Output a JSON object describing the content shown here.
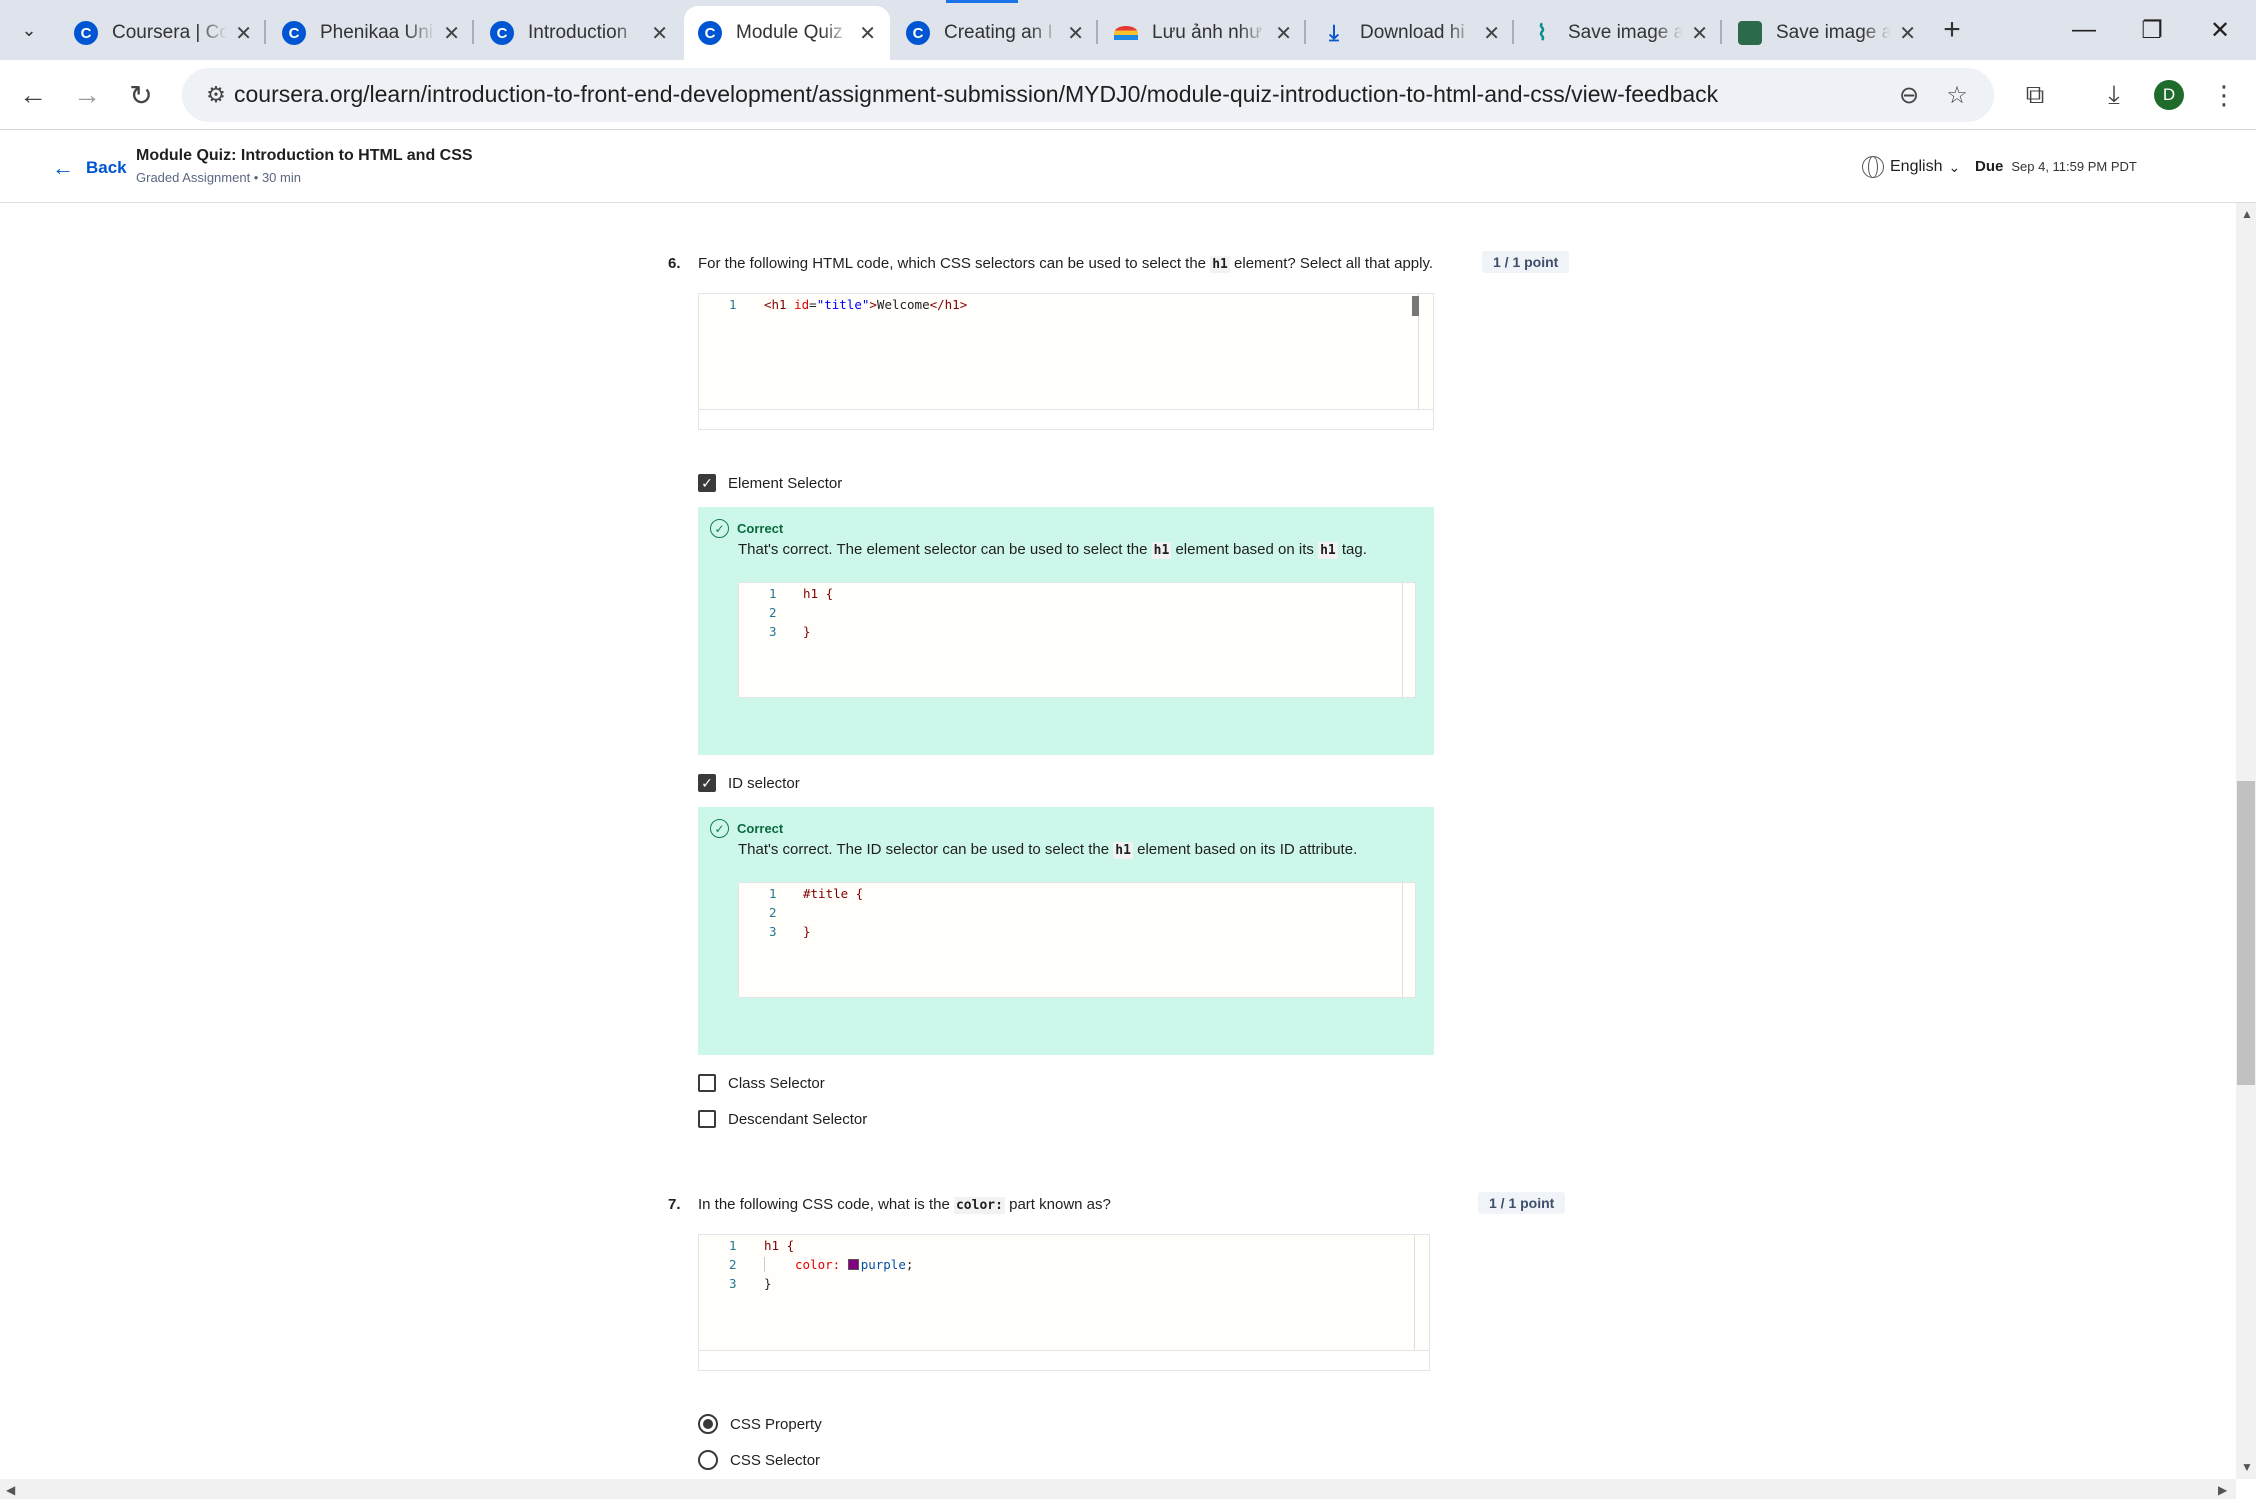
{
  "browser": {
    "tabs": [
      {
        "title": "Coursera | Co",
        "icon": "coursera-icon"
      },
      {
        "title": "Phenikaa Uni",
        "icon": "coursera-icon"
      },
      {
        "title": "Introduction",
        "icon": "coursera-icon"
      },
      {
        "title": "Module Quiz",
        "icon": "coursera-icon",
        "active": true
      },
      {
        "title": "Creating an I",
        "icon": "coursera-icon"
      },
      {
        "title": "Lưu ảnh như",
        "icon": "rainbow-icon"
      },
      {
        "title": "Download hi",
        "icon": "download-icon"
      },
      {
        "title": "Save image a",
        "icon": "waveform-icon"
      },
      {
        "title": "Save image a",
        "icon": "image-icon"
      }
    ],
    "url": "coursera.org/learn/introduction-to-front-end-development/assignment-submission/MYDJ0/module-quiz-introduction-to-html-and-css/view-feedback",
    "profile_initial": "D"
  },
  "header": {
    "back_label": "Back",
    "title": "Module Quiz: Introduction to HTML and CSS",
    "subtitle": "Graded Assignment • 30 min",
    "language": "English",
    "due_label": "Due",
    "due_value": "Sep 4, 11:59 PM PDT"
  },
  "q6": {
    "number": "6.",
    "text_before": "For the following HTML code, which CSS selectors can be used to select the",
    "text_code": "h1",
    "text_after": "element? Select all that apply.",
    "points": "1 / 1 point",
    "code_line_number": "1",
    "options": [
      {
        "label": "Element Selector",
        "checked": true,
        "feedback": {
          "status": "Correct",
          "text_before": "That's correct. The element selector can be used to select the",
          "code1": "h1",
          "text_mid": "element based on its",
          "code2": "h1",
          "text_after": "tag.",
          "code_lines": [
            "h1 {",
            "",
            "}"
          ]
        }
      },
      {
        "label": "ID selector",
        "checked": true,
        "feedback": {
          "status": "Correct",
          "text_before": "That's correct. The ID selector can be used to select the",
          "code1": "h1",
          "text_after": "element based on its ID attribute.",
          "code_lines": [
            "#title {",
            "",
            "}"
          ]
        }
      },
      {
        "label": "Class Selector",
        "checked": false
      },
      {
        "label": "Descendant Selector",
        "checked": false
      }
    ]
  },
  "q7": {
    "number": "7.",
    "text_before": "In the following CSS code, what is the",
    "text_code": "color:",
    "text_after": "part known as?",
    "points": "1 / 1 point",
    "code_line_numbers": [
      "1",
      "2",
      "3"
    ],
    "options": [
      {
        "label": "CSS Property",
        "selected": true
      },
      {
        "label": "CSS Selector",
        "selected": false
      }
    ]
  },
  "colors": {
    "coursera_blue": "#0056d2",
    "correct_bg": "#cdf7ea",
    "correct_text": "#0b6b3f",
    "swatch_purple": "#800080"
  }
}
